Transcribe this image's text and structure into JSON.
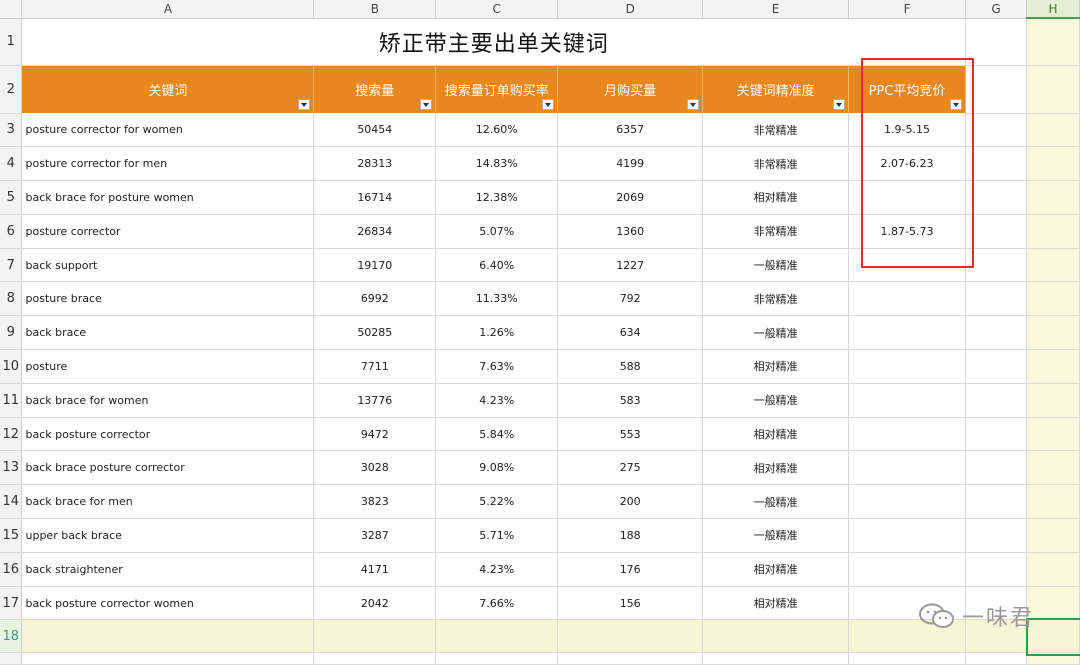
{
  "column_headers": [
    "A",
    "B",
    "C",
    "D",
    "E",
    "F",
    "G",
    "H"
  ],
  "title": "矫正带主要出单关键词",
  "table_headers": [
    "关键词",
    "搜索量",
    "搜索量订单购买率",
    "月购买量",
    "关键词精准度",
    "PPC平均竞价"
  ],
  "rows": [
    {
      "num": "3",
      "keyword": "posture corrector for women",
      "search": "50454",
      "rate": "12.60%",
      "monthly": "6357",
      "precision": "非常精准",
      "ppc": "1.9-5.15"
    },
    {
      "num": "4",
      "keyword": "posture corrector for men",
      "search": "28313",
      "rate": "14.83%",
      "monthly": "4199",
      "precision": "非常精准",
      "ppc": "2.07-6.23"
    },
    {
      "num": "5",
      "keyword": "back brace for posture women",
      "search": "16714",
      "rate": "12.38%",
      "monthly": "2069",
      "precision": "相对精准",
      "ppc": ""
    },
    {
      "num": "6",
      "keyword": "posture corrector",
      "search": "26834",
      "rate": "5.07%",
      "monthly": "1360",
      "precision": "非常精准",
      "ppc": "1.87-5.73"
    },
    {
      "num": "7",
      "keyword": "back support",
      "search": "19170",
      "rate": "6.40%",
      "monthly": "1227",
      "precision": "一般精准",
      "ppc": ""
    },
    {
      "num": "8",
      "keyword": "posture brace",
      "search": "6992",
      "rate": "11.33%",
      "monthly": "792",
      "precision": "非常精准",
      "ppc": ""
    },
    {
      "num": "9",
      "keyword": "back brace",
      "search": "50285",
      "rate": "1.26%",
      "monthly": "634",
      "precision": "一般精准",
      "ppc": ""
    },
    {
      "num": "10",
      "keyword": "posture",
      "search": "7711",
      "rate": "7.63%",
      "monthly": "588",
      "precision": "相对精准",
      "ppc": ""
    },
    {
      "num": "11",
      "keyword": "back brace for women",
      "search": "13776",
      "rate": "4.23%",
      "monthly": "583",
      "precision": "一般精准",
      "ppc": ""
    },
    {
      "num": "12",
      "keyword": "back posture corrector",
      "search": "9472",
      "rate": "5.84%",
      "monthly": "553",
      "precision": "相对精准",
      "ppc": ""
    },
    {
      "num": "13",
      "keyword": "back brace posture corrector",
      "search": "3028",
      "rate": "9.08%",
      "monthly": "275",
      "precision": "相对精准",
      "ppc": ""
    },
    {
      "num": "14",
      "keyword": "back brace for men",
      "search": "3823",
      "rate": "5.22%",
      "monthly": "200",
      "precision": "一般精准",
      "ppc": ""
    },
    {
      "num": "15",
      "keyword": "upper back brace",
      "search": "3287",
      "rate": "5.71%",
      "monthly": "188",
      "precision": "一般精准",
      "ppc": ""
    },
    {
      "num": "16",
      "keyword": "back straightener",
      "search": "4171",
      "rate": "4.23%",
      "monthly": "176",
      "precision": "相对精准",
      "ppc": ""
    },
    {
      "num": "17",
      "keyword": "back posture corrector women",
      "search": "2042",
      "rate": "7.66%",
      "monthly": "156",
      "precision": "相对精准",
      "ppc": ""
    }
  ],
  "row_numbers_extra": [
    "1",
    "2",
    "18"
  ],
  "watermark": "一味君",
  "colors": {
    "header_bg": "#e8871e",
    "highlight_box": "#e0302e",
    "selection": "#2f9e4a"
  }
}
